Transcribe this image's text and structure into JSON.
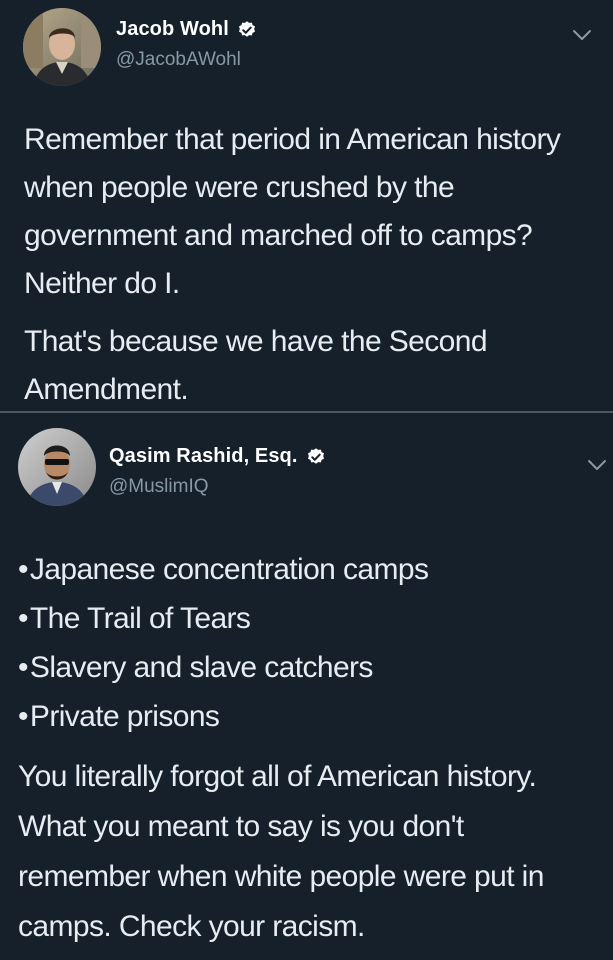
{
  "tweets": [
    {
      "display_name": "Jacob Wohl",
      "handle": "@JacobAWohl",
      "paragraphs": [
        "Remember that period in American history when people were crushed by the government and marched off to camps? Neither do I.",
        "That's because we have the Second Amendment."
      ]
    },
    {
      "display_name": "Qasim Rashid, Esq.",
      "handle": "@MuslimIQ",
      "bullets": [
        "Japanese concentration camps",
        "The Trail of Tears",
        "Slavery and slave catchers",
        "Private prisons"
      ],
      "bullet_char": "•",
      "paragraphs": [
        "You literally forgot all of American history. What you meant to say is you don't remember when white people were put in camps. Check your racism."
      ]
    }
  ],
  "colors": {
    "background": "#15202b",
    "text": "#e6ecf0",
    "secondary_text": "#8899a6",
    "verified_badge": "#ffffff",
    "divider": "#4a5663"
  },
  "icons": {
    "verified": "verified-badge-icon",
    "menu": "chevron-down-icon"
  }
}
